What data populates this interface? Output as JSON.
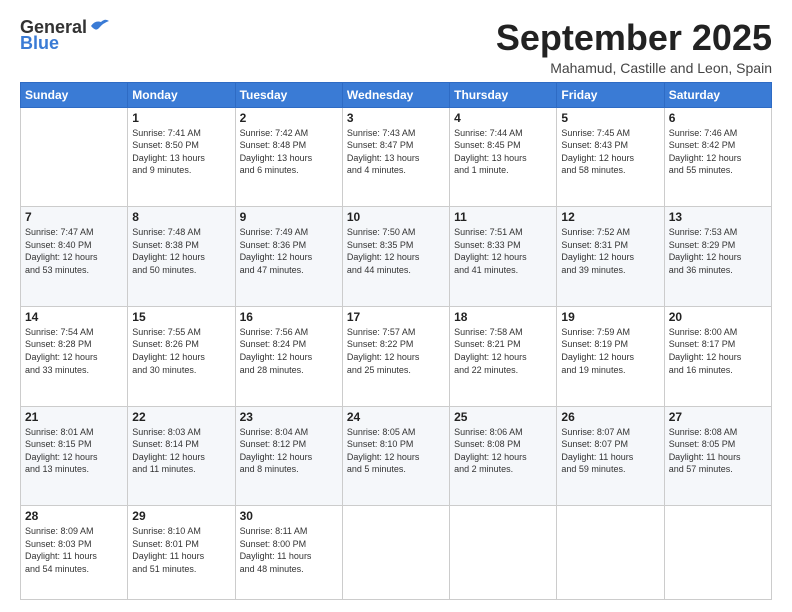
{
  "header": {
    "logo_general": "General",
    "logo_blue": "Blue",
    "month_title": "September 2025",
    "location": "Mahamud, Castille and Leon, Spain"
  },
  "weekdays": [
    "Sunday",
    "Monday",
    "Tuesday",
    "Wednesday",
    "Thursday",
    "Friday",
    "Saturday"
  ],
  "weeks": [
    [
      {
        "day": "",
        "info": ""
      },
      {
        "day": "1",
        "info": "Sunrise: 7:41 AM\nSunset: 8:50 PM\nDaylight: 13 hours\nand 9 minutes."
      },
      {
        "day": "2",
        "info": "Sunrise: 7:42 AM\nSunset: 8:48 PM\nDaylight: 13 hours\nand 6 minutes."
      },
      {
        "day": "3",
        "info": "Sunrise: 7:43 AM\nSunset: 8:47 PM\nDaylight: 13 hours\nand 4 minutes."
      },
      {
        "day": "4",
        "info": "Sunrise: 7:44 AM\nSunset: 8:45 PM\nDaylight: 13 hours\nand 1 minute."
      },
      {
        "day": "5",
        "info": "Sunrise: 7:45 AM\nSunset: 8:43 PM\nDaylight: 12 hours\nand 58 minutes."
      },
      {
        "day": "6",
        "info": "Sunrise: 7:46 AM\nSunset: 8:42 PM\nDaylight: 12 hours\nand 55 minutes."
      }
    ],
    [
      {
        "day": "7",
        "info": "Sunrise: 7:47 AM\nSunset: 8:40 PM\nDaylight: 12 hours\nand 53 minutes."
      },
      {
        "day": "8",
        "info": "Sunrise: 7:48 AM\nSunset: 8:38 PM\nDaylight: 12 hours\nand 50 minutes."
      },
      {
        "day": "9",
        "info": "Sunrise: 7:49 AM\nSunset: 8:36 PM\nDaylight: 12 hours\nand 47 minutes."
      },
      {
        "day": "10",
        "info": "Sunrise: 7:50 AM\nSunset: 8:35 PM\nDaylight: 12 hours\nand 44 minutes."
      },
      {
        "day": "11",
        "info": "Sunrise: 7:51 AM\nSunset: 8:33 PM\nDaylight: 12 hours\nand 41 minutes."
      },
      {
        "day": "12",
        "info": "Sunrise: 7:52 AM\nSunset: 8:31 PM\nDaylight: 12 hours\nand 39 minutes."
      },
      {
        "day": "13",
        "info": "Sunrise: 7:53 AM\nSunset: 8:29 PM\nDaylight: 12 hours\nand 36 minutes."
      }
    ],
    [
      {
        "day": "14",
        "info": "Sunrise: 7:54 AM\nSunset: 8:28 PM\nDaylight: 12 hours\nand 33 minutes."
      },
      {
        "day": "15",
        "info": "Sunrise: 7:55 AM\nSunset: 8:26 PM\nDaylight: 12 hours\nand 30 minutes."
      },
      {
        "day": "16",
        "info": "Sunrise: 7:56 AM\nSunset: 8:24 PM\nDaylight: 12 hours\nand 28 minutes."
      },
      {
        "day": "17",
        "info": "Sunrise: 7:57 AM\nSunset: 8:22 PM\nDaylight: 12 hours\nand 25 minutes."
      },
      {
        "day": "18",
        "info": "Sunrise: 7:58 AM\nSunset: 8:21 PM\nDaylight: 12 hours\nand 22 minutes."
      },
      {
        "day": "19",
        "info": "Sunrise: 7:59 AM\nSunset: 8:19 PM\nDaylight: 12 hours\nand 19 minutes."
      },
      {
        "day": "20",
        "info": "Sunrise: 8:00 AM\nSunset: 8:17 PM\nDaylight: 12 hours\nand 16 minutes."
      }
    ],
    [
      {
        "day": "21",
        "info": "Sunrise: 8:01 AM\nSunset: 8:15 PM\nDaylight: 12 hours\nand 13 minutes."
      },
      {
        "day": "22",
        "info": "Sunrise: 8:03 AM\nSunset: 8:14 PM\nDaylight: 12 hours\nand 11 minutes."
      },
      {
        "day": "23",
        "info": "Sunrise: 8:04 AM\nSunset: 8:12 PM\nDaylight: 12 hours\nand 8 minutes."
      },
      {
        "day": "24",
        "info": "Sunrise: 8:05 AM\nSunset: 8:10 PM\nDaylight: 12 hours\nand 5 minutes."
      },
      {
        "day": "25",
        "info": "Sunrise: 8:06 AM\nSunset: 8:08 PM\nDaylight: 12 hours\nand 2 minutes."
      },
      {
        "day": "26",
        "info": "Sunrise: 8:07 AM\nSunset: 8:07 PM\nDaylight: 11 hours\nand 59 minutes."
      },
      {
        "day": "27",
        "info": "Sunrise: 8:08 AM\nSunset: 8:05 PM\nDaylight: 11 hours\nand 57 minutes."
      }
    ],
    [
      {
        "day": "28",
        "info": "Sunrise: 8:09 AM\nSunset: 8:03 PM\nDaylight: 11 hours\nand 54 minutes."
      },
      {
        "day": "29",
        "info": "Sunrise: 8:10 AM\nSunset: 8:01 PM\nDaylight: 11 hours\nand 51 minutes."
      },
      {
        "day": "30",
        "info": "Sunrise: 8:11 AM\nSunset: 8:00 PM\nDaylight: 11 hours\nand 48 minutes."
      },
      {
        "day": "",
        "info": ""
      },
      {
        "day": "",
        "info": ""
      },
      {
        "day": "",
        "info": ""
      },
      {
        "day": "",
        "info": ""
      }
    ]
  ]
}
